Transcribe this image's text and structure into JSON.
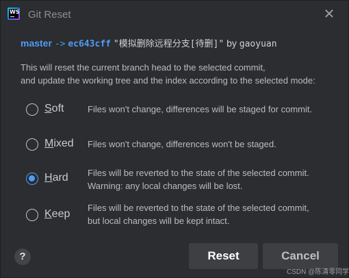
{
  "window": {
    "title": "Git Reset",
    "app_icon": "webstorm-icon",
    "close_icon": "close-icon"
  },
  "header": {
    "branch": "master",
    "arrow": "->",
    "commit_hash": "ec643cff",
    "commit_message": "\"模拟删除远程分支[待删]\"",
    "by": "by",
    "author": "gaoyuan"
  },
  "description": {
    "line1": "This will reset the current branch head to the selected commit,",
    "line2": "and update the working tree and the index according to the selected mode:"
  },
  "modes": [
    {
      "mnemonic": "S",
      "rest": "oft",
      "desc1": "Files won't change, differences will be staged for commit.",
      "desc2": "",
      "selected": false
    },
    {
      "mnemonic": "M",
      "rest": "ixed",
      "desc1": "Files won't change, differences won't be staged.",
      "desc2": "",
      "selected": false
    },
    {
      "mnemonic": "H",
      "rest": "ard",
      "desc1": "Files will be reverted to the state of the selected commit.",
      "desc2": "Warning: any local changes will be lost.",
      "selected": true
    },
    {
      "mnemonic": "K",
      "rest": "eep",
      "desc1": "Files will be reverted to the state of the selected commit,",
      "desc2": "but local changes will be kept intact.",
      "selected": false
    }
  ],
  "footer": {
    "help": "?",
    "reset_label": "Reset",
    "cancel_label": "Cancel",
    "watermark": "CSDN @陈清零同学"
  },
  "colors": {
    "accent": "#4f9cf5",
    "background": "#2b2d30",
    "button": "#3d3f43"
  }
}
